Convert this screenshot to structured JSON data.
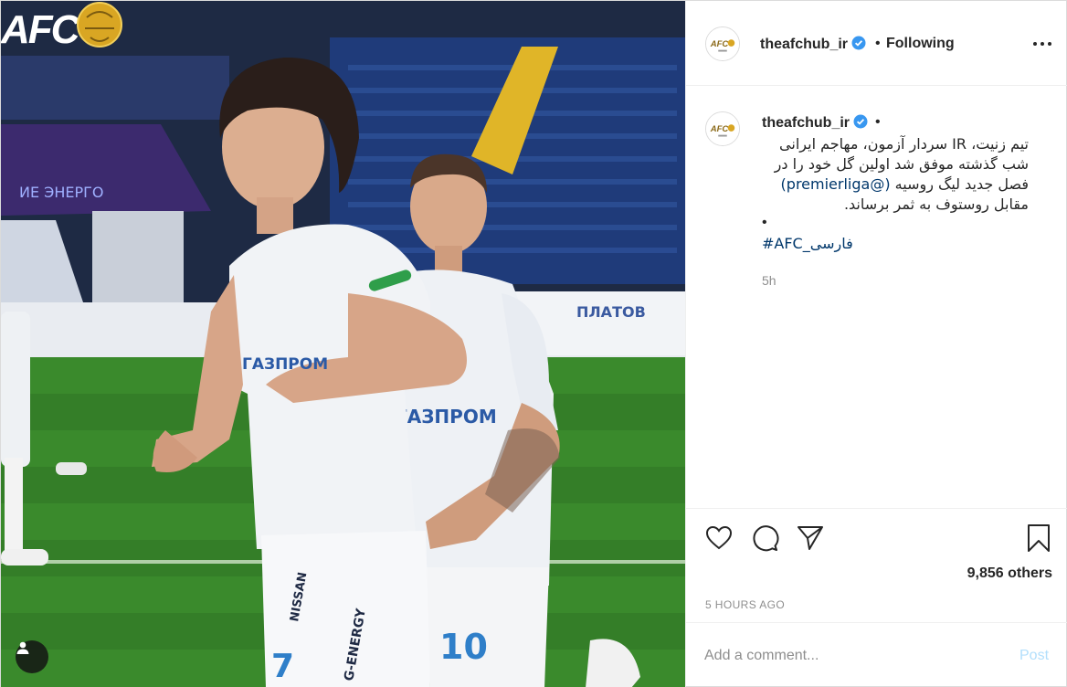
{
  "colors": {
    "accent": "#0095f6",
    "link": "#00376b",
    "muted": "#8e8e8e",
    "border": "#dbdbdb",
    "post_disabled": "#b2dffc"
  },
  "media": {
    "logo_text": "AFC",
    "jersey_sponsor": "ГАЗПРОМ",
    "shorts_sponsor": "NISSAN",
    "shorts_energy": "G-ENERGY",
    "number_left": "7",
    "number_right": "10",
    "stadium_board_left": "ИЕ ЭНЕРГО",
    "stadium_board_right": "ПЛАТОВ",
    "icons": [
      "afc-logo",
      "user-tag-icon"
    ]
  },
  "header": {
    "username": "theafchub_ir",
    "separator": "•",
    "follow_state": "Following"
  },
  "caption": {
    "username": "theafchub_ir",
    "separator": "•",
    "lines": [
      "تیم زنیت، IR سردار آزمون، مهاجم ایرانی",
      "شب گذشته موفق شد اولین گل خود را در",
      "فصل جدید لیگ روسیه ",
      "مقابل روستوف به ثمر برساند."
    ],
    "mention": "(@premierliga)",
    "bullet": "•",
    "hashtag": "#AFC_فارسی",
    "time_ago": "5h"
  },
  "actions": {
    "icons": [
      "heart-icon",
      "comment-icon",
      "share-icon",
      "save-icon"
    ],
    "likes_text": "9,856 others",
    "post_time": "5 HOURS AGO"
  },
  "comment": {
    "placeholder": "Add a comment...",
    "post_label": "Post"
  }
}
